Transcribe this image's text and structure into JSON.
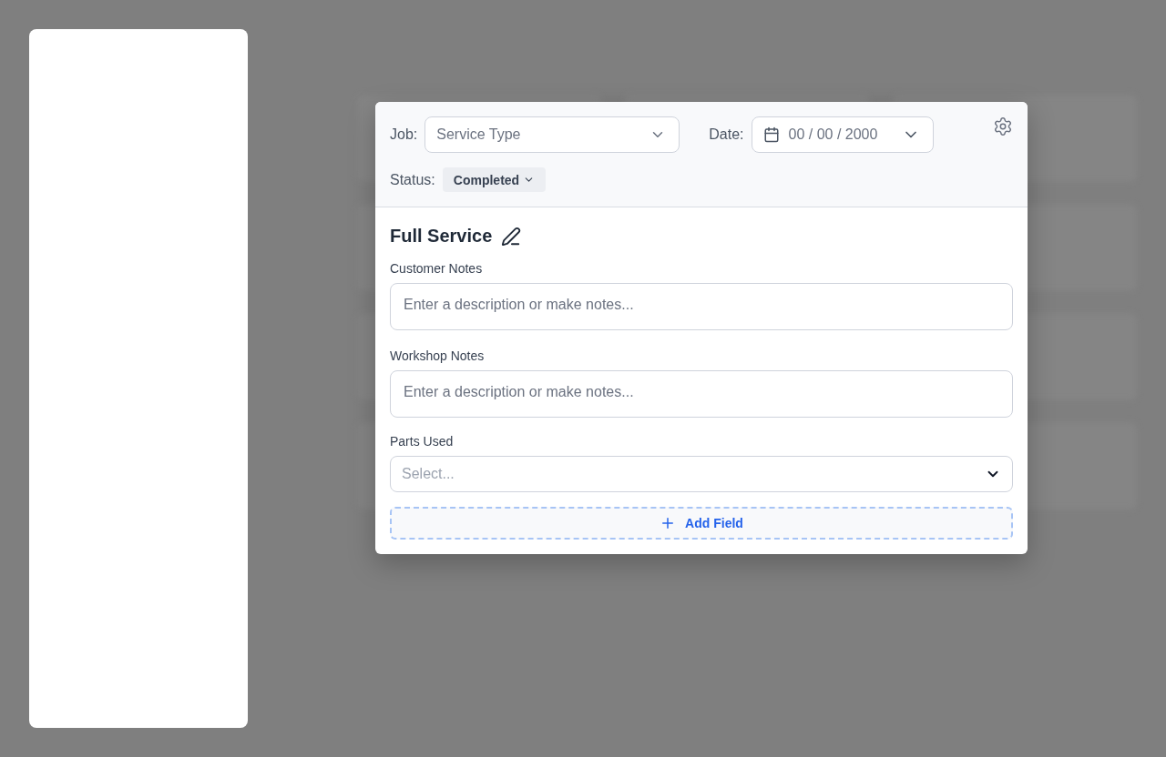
{
  "header": {
    "job": {
      "label": "Job:",
      "placeholder": "Service Type"
    },
    "date": {
      "label": "Date:",
      "value": "00 / 00 / 2000"
    },
    "status": {
      "label": "Status:",
      "value": "Completed"
    }
  },
  "title": "Full Service",
  "fields": [
    {
      "kind": "textarea",
      "label": "Customer Notes",
      "placeholder": "Enter a description or make notes..."
    },
    {
      "kind": "textarea",
      "label": "Workshop Notes",
      "placeholder": "Enter a description or make notes..."
    },
    {
      "kind": "select",
      "label": "Parts Used",
      "placeholder": "Select..."
    }
  ],
  "add_button": "Add Field"
}
